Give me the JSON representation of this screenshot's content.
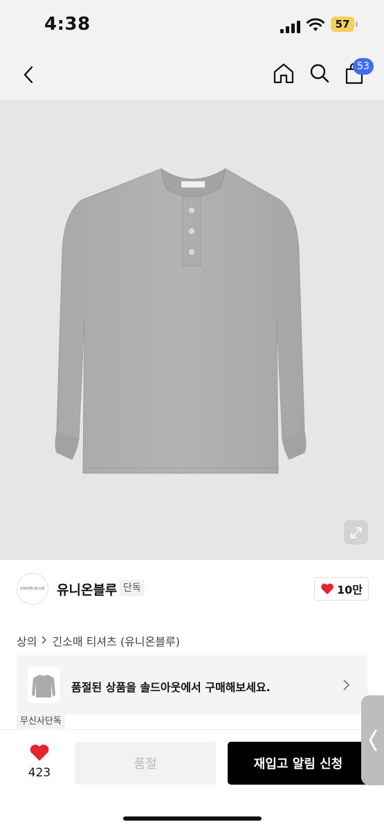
{
  "status_bar": {
    "time": "4:38",
    "battery": "57"
  },
  "nav": {
    "cart_count": "53"
  },
  "product": {
    "image_alt": "long sleeve henley t-shirt, heather gray"
  },
  "brand": {
    "logo_text": "UNION BLUE",
    "name": "유니온블루",
    "tag": "단독"
  },
  "likes": {
    "label": "10만"
  },
  "breadcrumb": {
    "items": [
      "상의",
      "긴소매 티셔츠 (유니온블루)"
    ]
  },
  "soldout_banner": {
    "text": "품절된 상품을 솔드아웃에서 구매해보세요."
  },
  "musinsa_tag": "무신사단독",
  "bottom_bar": {
    "heart_count": "423",
    "soldout_label": "품절",
    "restock_label": "재입고 알림 신청"
  },
  "colors": {
    "accent_blue": "#3d6df2",
    "heart_red": "#e5242c",
    "battery_yellow": "#f4d15a"
  }
}
